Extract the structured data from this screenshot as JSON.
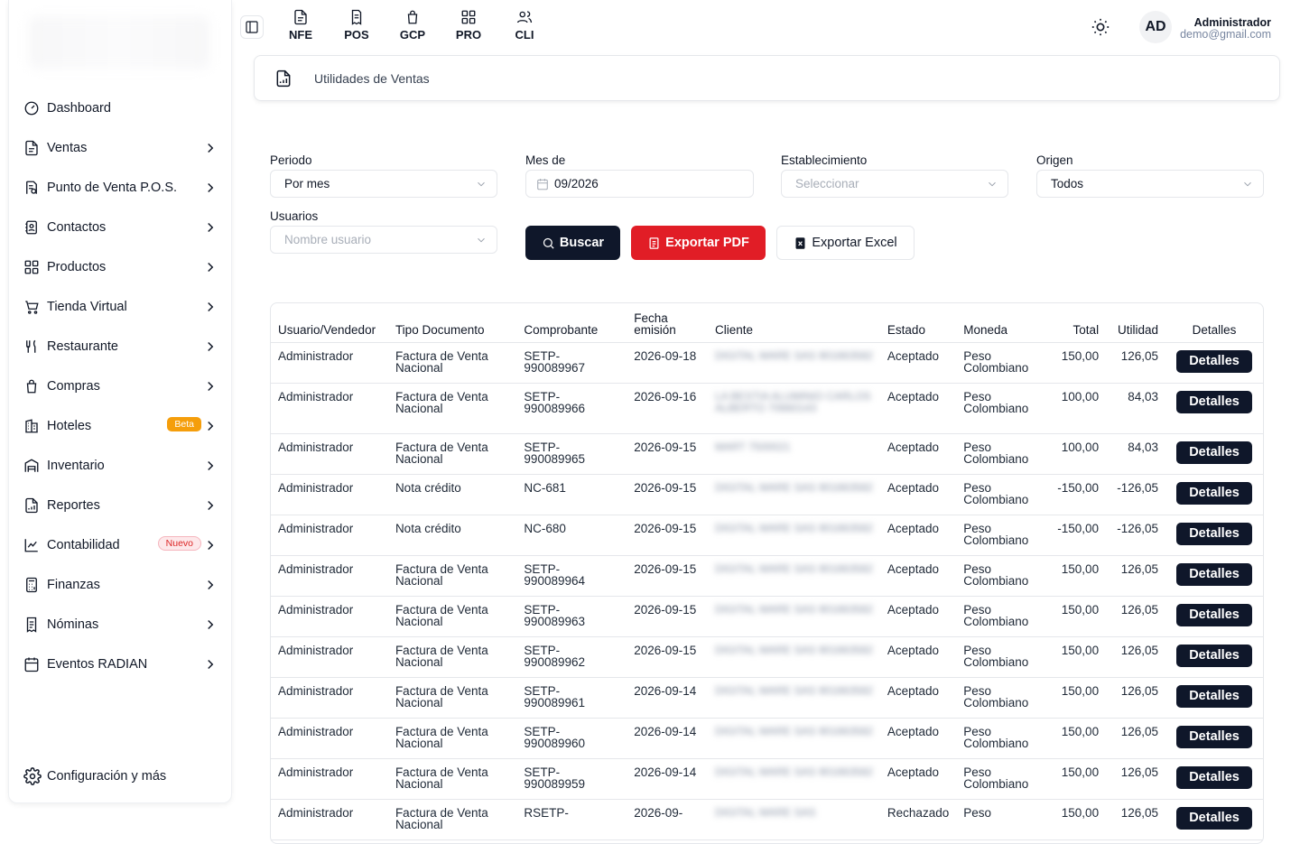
{
  "topbar": {
    "modules": [
      {
        "label": "NFE",
        "icon": "file-icon"
      },
      {
        "label": "POS",
        "icon": "receipt-icon"
      },
      {
        "label": "GCP",
        "icon": "bag-icon"
      },
      {
        "label": "PRO",
        "icon": "grid-icon"
      },
      {
        "label": "CLI",
        "icon": "users-icon"
      }
    ],
    "avatar_initials": "AD",
    "user_name": "Administrador",
    "user_email": "demo@gmail.com"
  },
  "sidebar": {
    "items": [
      {
        "label": "Dashboard",
        "icon": "dashboard-icon",
        "has_chevron": false
      },
      {
        "label": "Ventas",
        "icon": "file-icon",
        "has_chevron": true
      },
      {
        "label": "Punto de Venta P.O.S.",
        "icon": "pos-icon",
        "has_chevron": true
      },
      {
        "label": "Contactos",
        "icon": "contacts-icon",
        "has_chevron": true
      },
      {
        "label": "Productos",
        "icon": "grid-icon",
        "has_chevron": true
      },
      {
        "label": "Tienda Virtual",
        "icon": "cart-icon",
        "has_chevron": true
      },
      {
        "label": "Restaurante",
        "icon": "utensils-icon",
        "has_chevron": true
      },
      {
        "label": "Compras",
        "icon": "bag-icon",
        "has_chevron": true
      },
      {
        "label": "Hoteles",
        "icon": "hotel-icon",
        "has_chevron": true,
        "badge": "Beta"
      },
      {
        "label": "Inventario",
        "icon": "warehouse-icon",
        "has_chevron": true
      },
      {
        "label": "Reportes",
        "icon": "report-icon",
        "has_chevron": true
      },
      {
        "label": "Contabilidad",
        "icon": "chart-icon",
        "has_chevron": true,
        "badge": "Nuevo"
      },
      {
        "label": "Finanzas",
        "icon": "calculator-icon",
        "has_chevron": true
      },
      {
        "label": "Nóminas",
        "icon": "payroll-icon",
        "has_chevron": true
      },
      {
        "label": "Eventos RADIAN",
        "icon": "calendar-icon",
        "has_chevron": true
      }
    ],
    "config_label": "Configuración y más"
  },
  "breadcrumb": {
    "title": "Utilidades de Ventas"
  },
  "filters": {
    "periodo_label": "Periodo",
    "periodo_value": "Por mes",
    "mes_label": "Mes de",
    "mes_value": "09/2026",
    "establecimiento_label": "Establecimiento",
    "establecimiento_placeholder": "Seleccionar",
    "origen_label": "Origen",
    "origen_value": "Todos",
    "usuarios_label": "Usuarios",
    "usuarios_placeholder": "Nombre usuario"
  },
  "actions": {
    "buscar": "Buscar",
    "exportar_pdf": "Exportar PDF",
    "exportar_excel": "Exportar Excel"
  },
  "table": {
    "headers": [
      "Usuario/Vendedor",
      "Tipo Documento",
      "Comprobante",
      "Fecha emisión",
      "Cliente",
      "Estado",
      "Moneda",
      "Total",
      "Utilidad",
      "Detalles"
    ],
    "details_label": "Detalles",
    "rows": [
      {
        "usuario": "Administrador",
        "tipo": "Factura de Venta Nacional",
        "comprobante": "SETP-990089967",
        "fecha": "2026-09-18",
        "cliente": "DIGITAL WARE SAS 901663582",
        "estado": "Aceptado",
        "moneda": "Peso Colombiano",
        "total": "150,00",
        "utilidad": "126,05"
      },
      {
        "usuario": "Administrador",
        "tipo": "Factura de Venta Nacional",
        "comprobante": "SETP-990089966",
        "fecha": "2026-09-16",
        "cliente": "LA BESTIA ALUMINIO CARLOS ALBERTO 70660143",
        "estado": "Aceptado",
        "moneda": "Peso Colombiano",
        "total": "100,00",
        "utilidad": "84,03"
      },
      {
        "usuario": "Administrador",
        "tipo": "Factura de Venta Nacional",
        "comprobante": "SETP-990089965",
        "fecha": "2026-09-15",
        "cliente": "MART 7500021",
        "estado": "Aceptado",
        "moneda": "Peso Colombiano",
        "total": "100,00",
        "utilidad": "84,03"
      },
      {
        "usuario": "Administrador",
        "tipo": "Nota crédito",
        "comprobante": "NC-681",
        "fecha": "2026-09-15",
        "cliente": "DIGITAL WARE SAS 901663582",
        "estado": "Aceptado",
        "moneda": "Peso Colombiano",
        "total": "-150,00",
        "utilidad": "-126,05"
      },
      {
        "usuario": "Administrador",
        "tipo": "Nota crédito",
        "comprobante": "NC-680",
        "fecha": "2026-09-15",
        "cliente": "DIGITAL WARE SAS 901663582",
        "estado": "Aceptado",
        "moneda": "Peso Colombiano",
        "total": "-150,00",
        "utilidad": "-126,05"
      },
      {
        "usuario": "Administrador",
        "tipo": "Factura de Venta Nacional",
        "comprobante": "SETP-990089964",
        "fecha": "2026-09-15",
        "cliente": "DIGITAL WARE SAS 901663582",
        "estado": "Aceptado",
        "moneda": "Peso Colombiano",
        "total": "150,00",
        "utilidad": "126,05"
      },
      {
        "usuario": "Administrador",
        "tipo": "Factura de Venta Nacional",
        "comprobante": "SETP-990089963",
        "fecha": "2026-09-15",
        "cliente": "DIGITAL WARE SAS 901663582",
        "estado": "Aceptado",
        "moneda": "Peso Colombiano",
        "total": "150,00",
        "utilidad": "126,05"
      },
      {
        "usuario": "Administrador",
        "tipo": "Factura de Venta Nacional",
        "comprobante": "SETP-990089962",
        "fecha": "2026-09-15",
        "cliente": "DIGITAL WARE SAS 901663582",
        "estado": "Aceptado",
        "moneda": "Peso Colombiano",
        "total": "150,00",
        "utilidad": "126,05"
      },
      {
        "usuario": "Administrador",
        "tipo": "Factura de Venta Nacional",
        "comprobante": "SETP-990089961",
        "fecha": "2026-09-14",
        "cliente": "DIGITAL WARE SAS 901663582",
        "estado": "Aceptado",
        "moneda": "Peso Colombiano",
        "total": "150,00",
        "utilidad": "126,05"
      },
      {
        "usuario": "Administrador",
        "tipo": "Factura de Venta Nacional",
        "comprobante": "SETP-990089960",
        "fecha": "2026-09-14",
        "cliente": "DIGITAL WARE SAS 901663582",
        "estado": "Aceptado",
        "moneda": "Peso Colombiano",
        "total": "150,00",
        "utilidad": "126,05"
      },
      {
        "usuario": "Administrador",
        "tipo": "Factura de Venta Nacional",
        "comprobante": "SETP-990089959",
        "fecha": "2026-09-14",
        "cliente": "DIGITAL WARE SAS 901663582",
        "estado": "Aceptado",
        "moneda": "Peso Colombiano",
        "total": "150,00",
        "utilidad": "126,05"
      },
      {
        "usuario": "Administrador",
        "tipo": "Factura de Venta Nacional",
        "comprobante": "RSETP-",
        "fecha": "2026-09-",
        "cliente": "DIGITAL WARE SAS",
        "estado": "Rechazado",
        "moneda": "Peso",
        "total": "150,00",
        "utilidad": "126,05"
      }
    ]
  }
}
